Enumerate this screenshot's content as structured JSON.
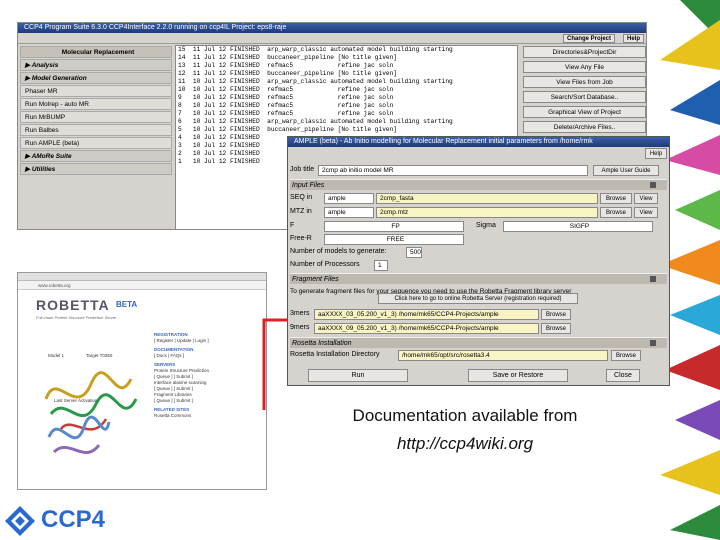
{
  "main_window": {
    "title": "CCP4 Program Suite 6.3.0 CCP4Interface 2.2.0 running on ccp4IL   Project: eps8-raje",
    "top_buttons": [
      "Change Project",
      "Help"
    ],
    "module": "Molecular Replacement",
    "menu": [
      {
        "label": "Analysis",
        "kind": "sec"
      },
      {
        "label": "Model Generation",
        "kind": "sec"
      },
      {
        "label": "Phaser MR",
        "kind": "item"
      },
      {
        "label": "Run Molrep - auto MR",
        "kind": "item"
      },
      {
        "label": "Run MrBUMP",
        "kind": "item"
      },
      {
        "label": "Run Balbes",
        "kind": "item"
      },
      {
        "label": "Run AMPLE (beta)",
        "kind": "item"
      },
      {
        "label": "AMoRe Suite",
        "kind": "sec"
      },
      {
        "label": "Utilities",
        "kind": "sec"
      }
    ],
    "jobs": [
      "15  11 Jul 12 FINISHED  arp_warp_classic automated model building starting",
      "14  11 Jul 12 FINISHED  buccaneer_pipeline [No title given]",
      "13  11 Jul 12 FINISHED  refmac5            refine jac soln",
      "12  11 Jul 12 FINISHED  buccaneer_pipeline [No title given]",
      "11  10 Jul 12 FINISHED  arp_warp_classic automated model building starting",
      "10  10 Jul 12 FINISHED  refmac5            refine jac soln",
      "9   10 Jul 12 FINISHED  refmac5            refine jac soln",
      "8   10 Jul 12 FINISHED  refmac5            refine jac soln",
      "7   10 Jul 12 FINISHED  refmac5            refine jac soln",
      "6   10 Jul 12 FINISHED  arp_warp_classic automated model building starting",
      "5   10 Jul 12 FINISHED  buccaneer_pipeline [No title given]",
      "4   10 Jul 12 FINISHED",
      "3   10 Jul 12 FINISHED",
      "2   10 Jul 12 FINISHED",
      "1   10 Jul 12 FINISHED"
    ],
    "right_buttons": [
      "Directories&ProjectDir",
      "View Any File",
      "View Files from Job",
      "Search/Sort Database..",
      "Graphical View of Project",
      "Delete/Archive Files..",
      "Kill Job"
    ]
  },
  "robetta": {
    "url": "www.robetta.org",
    "logo": "ROBETTA",
    "beta": "BETA",
    "subtitle": "Full-chain Protein Structure Prediction Server",
    "nav": [
      {
        "h": "REGISTRATION",
        "t": "[ Register | Update | Login ]"
      },
      {
        "h": "DOCUMENTATION",
        "t": "[ Docs | FAQs ]"
      },
      {
        "h": "SERVERS",
        "t": "Protein Structure Prediction"
      },
      {
        "h": "",
        "t": "[ Queue ] [ Submit ]"
      },
      {
        "h": "",
        "t": "Interface alanine scanning"
      },
      {
        "h": "",
        "t": "[ Queue ] [ Submit ]"
      },
      {
        "h": "",
        "t": "Fragment Libraries"
      },
      {
        "h": "",
        "t": "[ Queue ] [ Submit ]"
      },
      {
        "h": "RELATED SITES",
        "t": "Rosetta Commons"
      }
    ],
    "captions": [
      "Model 1",
      "Target T0350",
      "Last Server Activation"
    ]
  },
  "ample": {
    "title": "AMPLE (beta) - Ab Initio modelling for Molecular Replacement   initial parameters from /home/rmk",
    "help": "Help",
    "job_title_label": "Job title",
    "job_title": "2cmp ab initio model MR",
    "user_guide": "Ample User Guide",
    "input_files": "Input Files",
    "seq_label": "SEQ in",
    "seq_dir": "ample",
    "seq_file": "2cmp_fasta",
    "mtz_label": "MTZ in",
    "mtz_dir": "ample",
    "mtz_file": "2cmp.mtz",
    "browse": "Browse",
    "view": "View",
    "f_label": "F",
    "f_value": "FP",
    "sigma_label": "Sigma",
    "sigma_value": "SIGFP",
    "freer_label": "Free-R",
    "freer_value": "FREE",
    "models_label": "Number of models to generate:",
    "models_value": "500",
    "procs_label": "Number of Processors",
    "procs_value": "1",
    "fragment_files": "Fragment Files",
    "fragment_text": "To generate fragment files for your sequence you need to use the Robetta Fragment library server",
    "robetta_btn": "Click here to go to online Robetta Server (registration required)",
    "mer3_label": "3mers",
    "mer3_value": "aaXXXX_03_05.200_v1_3) /home/mk65/CCP4-Projects/ample",
    "mer9_label": "9mers",
    "mer9_value": "aaXXXX_09_05.200_v1_3) /home/mk65/CCP4-Projects/ample",
    "rosetta_section": "Rosetta Installation",
    "rosetta_label": "Rosetta Installation Directory",
    "rosetta_value": "/home/mk65/opt/src/rosetta3.4",
    "run": "Run",
    "save_restore": "Save or Restore",
    "close": "Close"
  },
  "doc_line1": "Documentation available from",
  "doc_line2": "http://ccp4wiki.org",
  "footer_logo": "CCP4"
}
